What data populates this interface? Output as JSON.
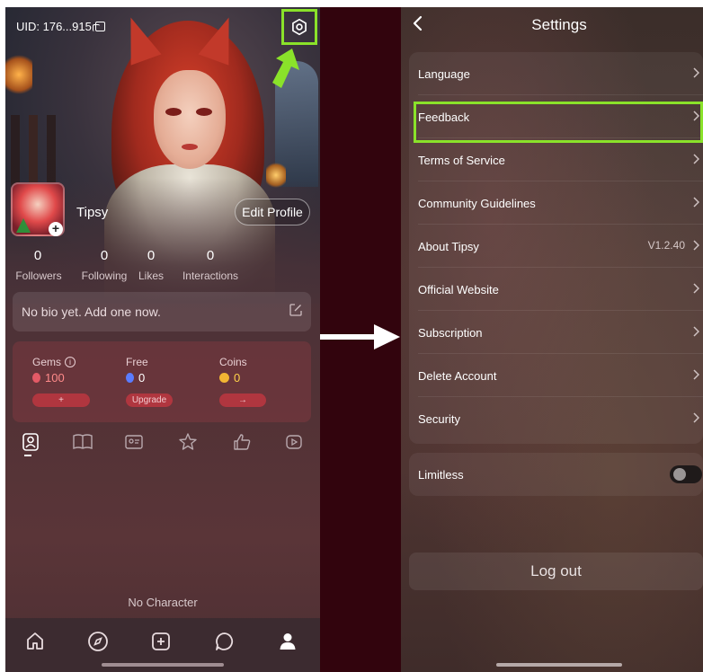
{
  "profile": {
    "uid": "UID: 176...915",
    "username": "Tipsy",
    "edit_profile_label": "Edit Profile",
    "stats": [
      {
        "value": "0",
        "label": "Followers"
      },
      {
        "value": "0",
        "label": "Following"
      },
      {
        "value": "0",
        "label": "Likes"
      },
      {
        "value": "0",
        "label": "Interactions"
      }
    ],
    "bio_placeholder": "No bio yet. Add one now.",
    "wallet": {
      "gems_label": "Gems",
      "gems_value": "100",
      "gems_button": "+",
      "free_label": "Free",
      "free_value": "0",
      "free_button": "Upgrade",
      "coins_label": "Coins",
      "coins_value": "0",
      "coins_button": "→"
    },
    "tab_icons": [
      "person-icon",
      "book-icon",
      "id-card-icon",
      "star-hand-icon",
      "thumbs-up-icon",
      "video-icon"
    ],
    "empty_state": "No Character",
    "bottom_nav": [
      "home-icon",
      "compass-icon",
      "plus-square-icon",
      "chat-icon",
      "profile-icon"
    ]
  },
  "settings": {
    "title": "Settings",
    "items": [
      {
        "label": "Language"
      },
      {
        "label": "Feedback"
      },
      {
        "label": "Terms of Service"
      },
      {
        "label": "Community Guidelines"
      },
      {
        "label": "About Tipsy",
        "value": "V1.2.40"
      },
      {
        "label": "Official Website"
      },
      {
        "label": "Subscription"
      },
      {
        "label": "Delete Account"
      },
      {
        "label": "Security"
      }
    ],
    "limitless_label": "Limitless",
    "limitless_on": false,
    "logout_label": "Log out"
  },
  "colors": {
    "highlight": "#8ae22a",
    "divider_panel": "#32040d",
    "wallet_button": "#b0363f"
  }
}
